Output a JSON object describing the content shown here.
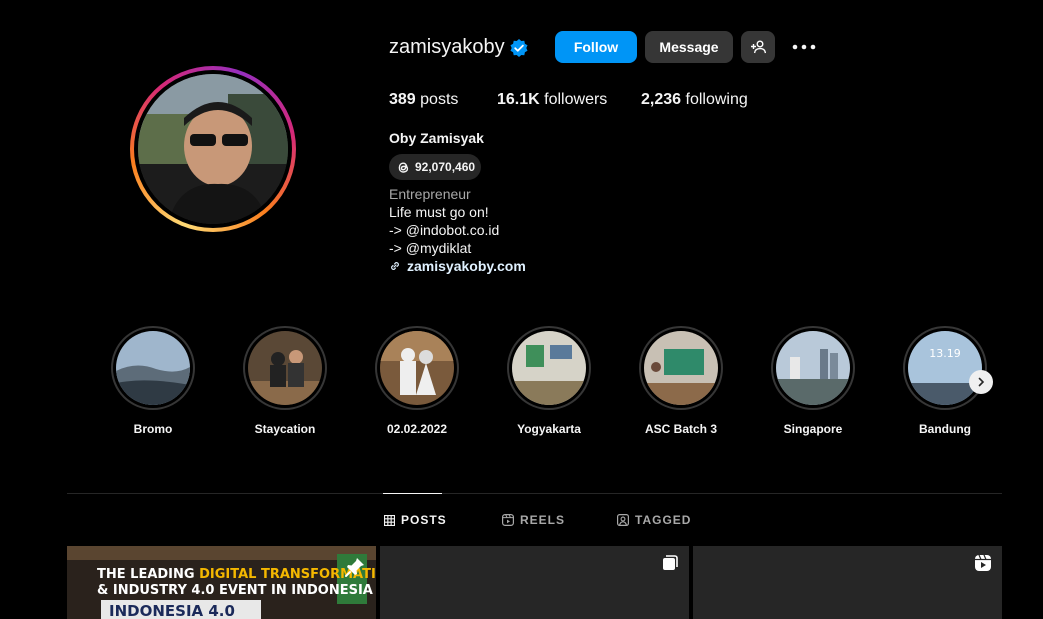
{
  "profile": {
    "username": "zamisyakoby",
    "follow_label": "Follow",
    "message_label": "Message",
    "stats": {
      "posts_count": "389",
      "posts_label": "posts",
      "followers_count": "16.1K",
      "followers_label": "followers",
      "following_count": "2,236",
      "following_label": "following"
    },
    "full_name": "Oby Zamisyak",
    "threads_count": "92,070,460",
    "category": "Entrepreneur",
    "bio_lines": [
      "Life must go on!",
      "-> @indobot.co.id",
      "-> @mydiklat"
    ],
    "link": "zamisyakoby.com"
  },
  "highlights": [
    {
      "label": "Bromo"
    },
    {
      "label": "Staycation"
    },
    {
      "label": "02.02.2022"
    },
    {
      "label": "Yogyakarta"
    },
    {
      "label": "ASC Batch 3"
    },
    {
      "label": "Singapore"
    },
    {
      "label": "Bandung"
    }
  ],
  "highlight_time_text": "13.19",
  "tabs": [
    {
      "label": "POSTS",
      "active": true
    },
    {
      "label": "REELS",
      "active": false
    },
    {
      "label": "TAGGED",
      "active": false
    }
  ],
  "posts": {
    "first_banner": {
      "line1_a": "THE LEADING ",
      "line1_b": "DIGITAL TRANSFORMATION",
      "line2": "& INDUSTRY 4.0 EVENT IN INDONESIA",
      "line3": "INDONESIA 4.0"
    }
  },
  "colors": {
    "accent": "#0095f6",
    "background": "#000000",
    "button_secondary": "#363636",
    "text_secondary": "#a8a8a8"
  }
}
